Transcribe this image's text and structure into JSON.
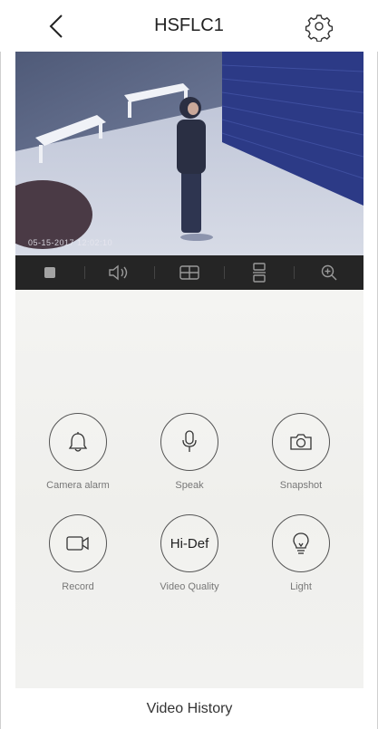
{
  "header": {
    "title": "HSFLC1"
  },
  "video": {
    "timestamp": "05-15-2017 12:02:10"
  },
  "controls": {
    "buttons": [
      {
        "label": "Camera alarm"
      },
      {
        "label": "Speak"
      },
      {
        "label": "Snapshot"
      },
      {
        "label": "Record"
      },
      {
        "label": "Hi-Def",
        "caption": "Video Quality"
      },
      {
        "label": "Light"
      }
    ]
  },
  "footer": {
    "history_label": "Video History"
  },
  "colors": {
    "control_bar": "#252525",
    "icon": "#9a9a9a",
    "accent": "#6d7897"
  }
}
